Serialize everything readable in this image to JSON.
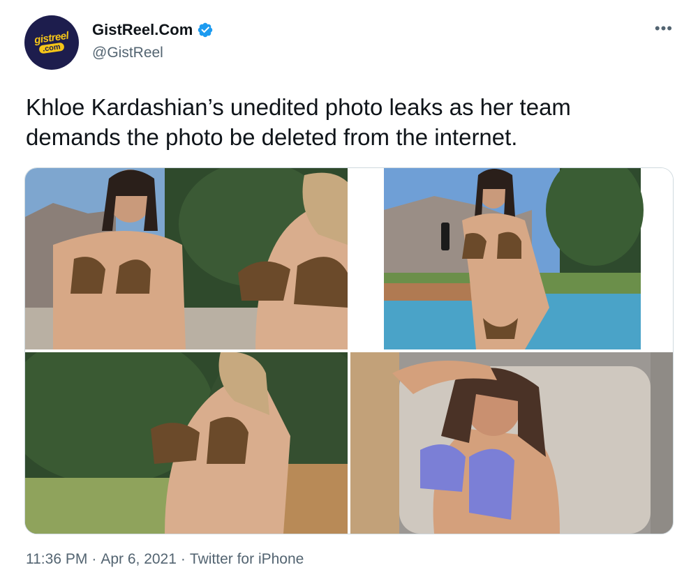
{
  "author": {
    "display_name": "GistReel.Com",
    "handle": "@GistReel",
    "verified": true,
    "avatar_text_top": "gistreel",
    "avatar_text_bottom": ".com"
  },
  "tweet": {
    "text": "Khloe Kardashian’s unedited photo leaks as her team demands the photo be deleted from the internet."
  },
  "meta": {
    "time": "11:36 PM",
    "separator": "·",
    "date": "Apr 6, 2021",
    "source": "Twitter for iPhone"
  },
  "colors": {
    "accent": "#1d9bf0",
    "text_primary": "#0f1419",
    "text_secondary": "#536471",
    "avatar_bg": "#1d1d4d",
    "avatar_logo": "#f5c518"
  },
  "icons": {
    "verified": "verified-badge-icon",
    "more": "more-options-icon"
  }
}
